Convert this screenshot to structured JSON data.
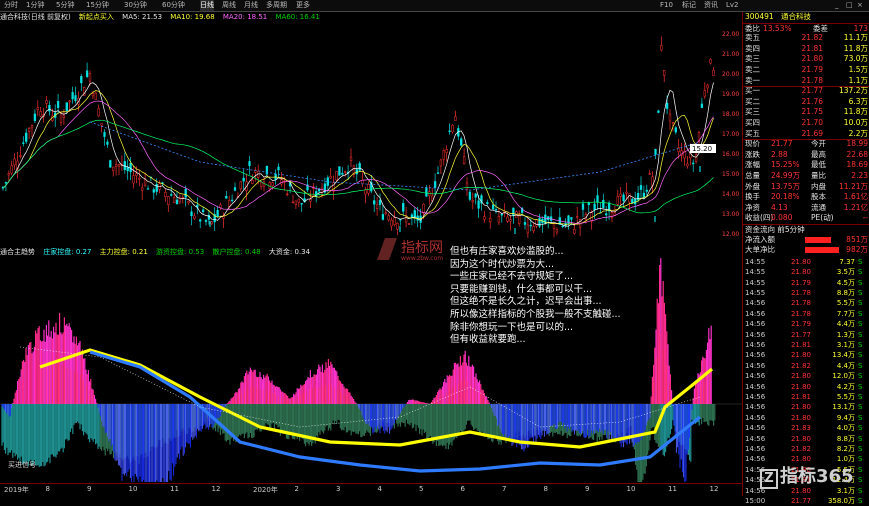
{
  "topbar": {
    "tabs": [
      "分时",
      "1分钟",
      "5分钟",
      "15分钟",
      "30分钟",
      "60分钟",
      "日线",
      "周线",
      "月线",
      "多周期",
      "更多"
    ],
    "active_tab": 6,
    "right_buttons": [
      "F10",
      "标记",
      "资讯",
      "Lv2"
    ]
  },
  "title_bar": {
    "stock": "通合科技(日线 前复权)",
    "indicator": "新起点买入",
    "ma_values": [
      "MA5: 21.53",
      "MA10: 19.68",
      "MA20: 18.51",
      "MA60: 16.41"
    ]
  },
  "main_chart": {
    "price_labels": [
      "22.00",
      "21.00",
      "20.00",
      "19.00",
      "18.00",
      "17.00",
      "16.00",
      "15.00",
      "14.00",
      "13.00",
      "12.00"
    ],
    "highlight_value": "15.20"
  },
  "sub_legend": {
    "name": "通合主趋势",
    "items": [
      "庄家控盘: 0.27",
      "主力控盘: 0.21",
      "游资控盘: 0.53",
      "散户控盘: 0.48",
      "大资金: 0.34"
    ]
  },
  "watermark": {
    "text": "指标网",
    "sub": "www.zbw.com"
  },
  "comment_lines": [
    "但也有庄家喜欢炒滥股的...",
    "因为这个时代炒票为大...",
    "一些庄家已经不去守规矩了...",
    "只要能赚到钱，什么事都可以干...",
    "但这绝不是长久之计，迟早会出事...",
    "所以像这样指标的个股我一般不支触碰...",
    "除非你想玩一下也是可以的...",
    "但有收益就要跑..."
  ],
  "sub_bottom_label": "买进信号",
  "date_labels": [
    "2019年",
    "8",
    "9",
    "10",
    "11",
    "12",
    "2020年",
    "2",
    "3",
    "4",
    "5",
    "6",
    "7",
    "8",
    "9",
    "10",
    "11",
    "12"
  ],
  "right_panel": {
    "code": "300491",
    "name": "通合科技",
    "weibi": {
      "label": "委比",
      "value": "13.53%",
      "label2": "委差",
      "value2": "173"
    },
    "sell_orders": [
      {
        "label": "卖五",
        "price": "21.82",
        "vol": "11.1万"
      },
      {
        "label": "卖四",
        "price": "21.81",
        "vol": "11.8万"
      },
      {
        "label": "卖三",
        "price": "21.80",
        "vol": "73.0万"
      },
      {
        "label": "卖二",
        "price": "21.79",
        "vol": "1.5万"
      },
      {
        "label": "卖一",
        "price": "21.78",
        "vol": "1.1万"
      }
    ],
    "buy_orders": [
      {
        "label": "买一",
        "price": "21.77",
        "vol": "137.2万"
      },
      {
        "label": "买二",
        "price": "21.76",
        "vol": "6.3万"
      },
      {
        "label": "买三",
        "price": "21.75",
        "vol": "11.8万"
      },
      {
        "label": "买四",
        "price": "21.70",
        "vol": "10.0万"
      },
      {
        "label": "买五",
        "price": "21.69",
        "vol": "2.2万"
      }
    ],
    "stats": [
      {
        "l1": "现价",
        "v1": "21.77",
        "l2": "今开",
        "v2": "18.99"
      },
      {
        "l1": "涨跌",
        "v1": "2.88",
        "l2": "最高",
        "v2": "22.68"
      },
      {
        "l1": "涨幅",
        "v1": "15.25%",
        "l2": "最低",
        "v2": "18.69"
      },
      {
        "l1": "总量",
        "v1": "24.99万",
        "l2": "量比",
        "v2": "2.23"
      },
      {
        "l1": "外盘",
        "v1": "13.75万",
        "l2": "内盘",
        "v2": "11.21万"
      },
      {
        "l1": "换手",
        "v1": "20.18%",
        "l2": "股本",
        "v2": "1.61亿"
      },
      {
        "l1": "净资",
        "v1": "4.13",
        "l2": "流通",
        "v2": "1.21亿"
      },
      {
        "l1": "收益(四)",
        "v1": "0.080",
        "l2": "PE(动)",
        "v2": "--"
      }
    ],
    "flow_header": "资金流向  前5分钟",
    "flow": [
      {
        "label": "净流入额",
        "value": "851万"
      },
      {
        "label": "大单净比",
        "value": "982万"
      }
    ],
    "ticks": [
      {
        "t": "14:55",
        "p": "21.80",
        "v": "7.37",
        "d": "S"
      },
      {
        "t": "14:55",
        "p": "21.80",
        "v": "3.5万",
        "d": "S"
      },
      {
        "t": "14:55",
        "p": "21.79",
        "v": "4.5万",
        "d": "S"
      },
      {
        "t": "14:55",
        "p": "21.78",
        "v": "8.8万",
        "d": "S"
      },
      {
        "t": "14:56",
        "p": "21.78",
        "v": "5.5万",
        "d": "S"
      },
      {
        "t": "14:56",
        "p": "21.78",
        "v": "7.7万",
        "d": "S"
      },
      {
        "t": "14:56",
        "p": "21.79",
        "v": "4.4万",
        "d": "S"
      },
      {
        "t": "14:56",
        "p": "21.77",
        "v": "1.3万",
        "d": "S"
      },
      {
        "t": "14:56",
        "p": "21.81",
        "v": "3.1万",
        "d": "S"
      },
      {
        "t": "14:56",
        "p": "21.80",
        "v": "13.4万",
        "d": "S"
      },
      {
        "t": "14:56",
        "p": "21.82",
        "v": "4.4万",
        "d": "S"
      },
      {
        "t": "14:56",
        "p": "21.80",
        "v": "12.0万",
        "d": "S"
      },
      {
        "t": "14:56",
        "p": "21.80",
        "v": "4.2万",
        "d": "S"
      },
      {
        "t": "14:56",
        "p": "21.81",
        "v": "5.5万",
        "d": "S"
      },
      {
        "t": "14:56",
        "p": "21.80",
        "v": "13.1万",
        "d": "S"
      },
      {
        "t": "14:56",
        "p": "21.80",
        "v": "9.4万",
        "d": "S"
      },
      {
        "t": "14:56",
        "p": "21.83",
        "v": "4.0万",
        "d": "S"
      },
      {
        "t": "14:56",
        "p": "21.80",
        "v": "8.8万",
        "d": "S"
      },
      {
        "t": "14:56",
        "p": "21.82",
        "v": "8.2万",
        "d": "S"
      },
      {
        "t": "14:56",
        "p": "21.80",
        "v": "1.0万",
        "d": "S"
      },
      {
        "t": "14:56",
        "p": "21.80",
        "v": "5.5万",
        "d": "S"
      },
      {
        "t": "14:56",
        "p": "21.81",
        "v": "12.4万",
        "d": "S"
      },
      {
        "t": "14:56",
        "p": "21.80",
        "v": "3.1万",
        "d": "S"
      },
      {
        "t": "15:00",
        "p": "21.77",
        "v": "358.0万",
        "d": "S"
      }
    ]
  },
  "brand": "指标365"
}
